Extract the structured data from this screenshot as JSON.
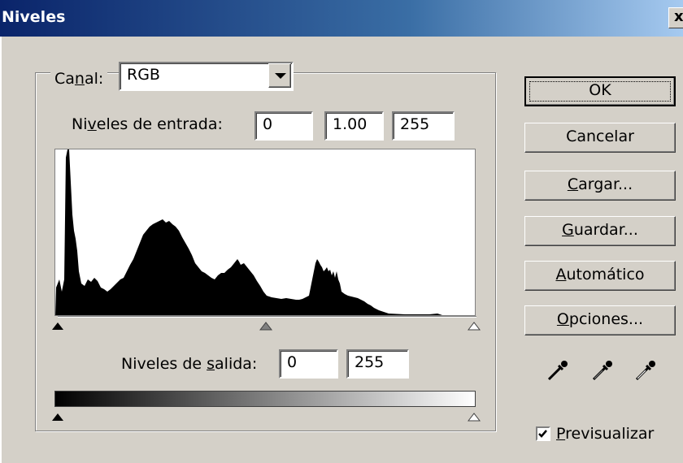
{
  "window": {
    "title": "Niveles",
    "close_glyph": "x"
  },
  "channel": {
    "label_pre": "Ca",
    "label_u": "n",
    "label_post": "al:",
    "value": "RGB"
  },
  "input_levels": {
    "label_pre": "Ni",
    "label_u": "v",
    "label_post": "eles de entrada:",
    "black": "0",
    "gamma": "1.00",
    "white": "255"
  },
  "output_levels": {
    "label_pre": "Niveles de ",
    "label_u": "s",
    "label_post": "alida:",
    "black": "0",
    "white": "255"
  },
  "buttons": {
    "ok": "OK",
    "cancel": "Cancelar",
    "load_u": "C",
    "load_rest": "argar...",
    "save_u": "G",
    "save_rest": "uardar...",
    "auto_u": "A",
    "auto_rest": "utomático",
    "options_u": "O",
    "options_rest": "pciones..."
  },
  "preview": {
    "label_u": "P",
    "label_rest": "revisualizar",
    "checked": true
  },
  "icons": [
    "eyedropper-black-icon",
    "eyedropper-gray-icon",
    "eyedropper-white-icon"
  ],
  "colors": {
    "titlebar_start": "#0a246a",
    "titlebar_end": "#a6caf0",
    "face": "#d4d0c8"
  }
}
